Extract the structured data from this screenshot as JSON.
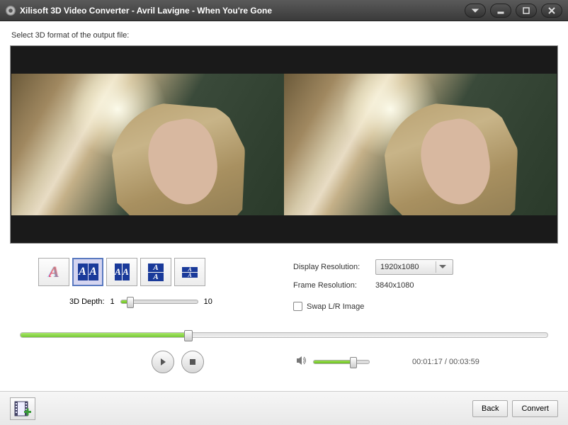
{
  "window": {
    "title": "Xilisoft 3D Video Converter - Avril Lavigne - When You're Gone"
  },
  "instruction": "Select 3D format of the output file:",
  "formats": {
    "anaglyph": "A",
    "sbs_full_l": "A",
    "sbs_full_r": "A",
    "sbs_half_l": "A",
    "sbs_half_r": "A",
    "tb_full_t": "A",
    "tb_full_b": "A",
    "tb_half_t": "A",
    "tb_half_b": "A"
  },
  "depth": {
    "label": "3D Depth:",
    "min": "1",
    "max": "10"
  },
  "resolution": {
    "display_label": "Display Resolution:",
    "display_value": "1920x1080",
    "frame_label": "Frame Resolution:",
    "frame_value": "3840x1080"
  },
  "swap": {
    "label": "Swap L/R Image"
  },
  "playback": {
    "current": "00:01:17",
    "total": "00:03:59",
    "separator": " / "
  },
  "buttons": {
    "back": "Back",
    "convert": "Convert"
  }
}
